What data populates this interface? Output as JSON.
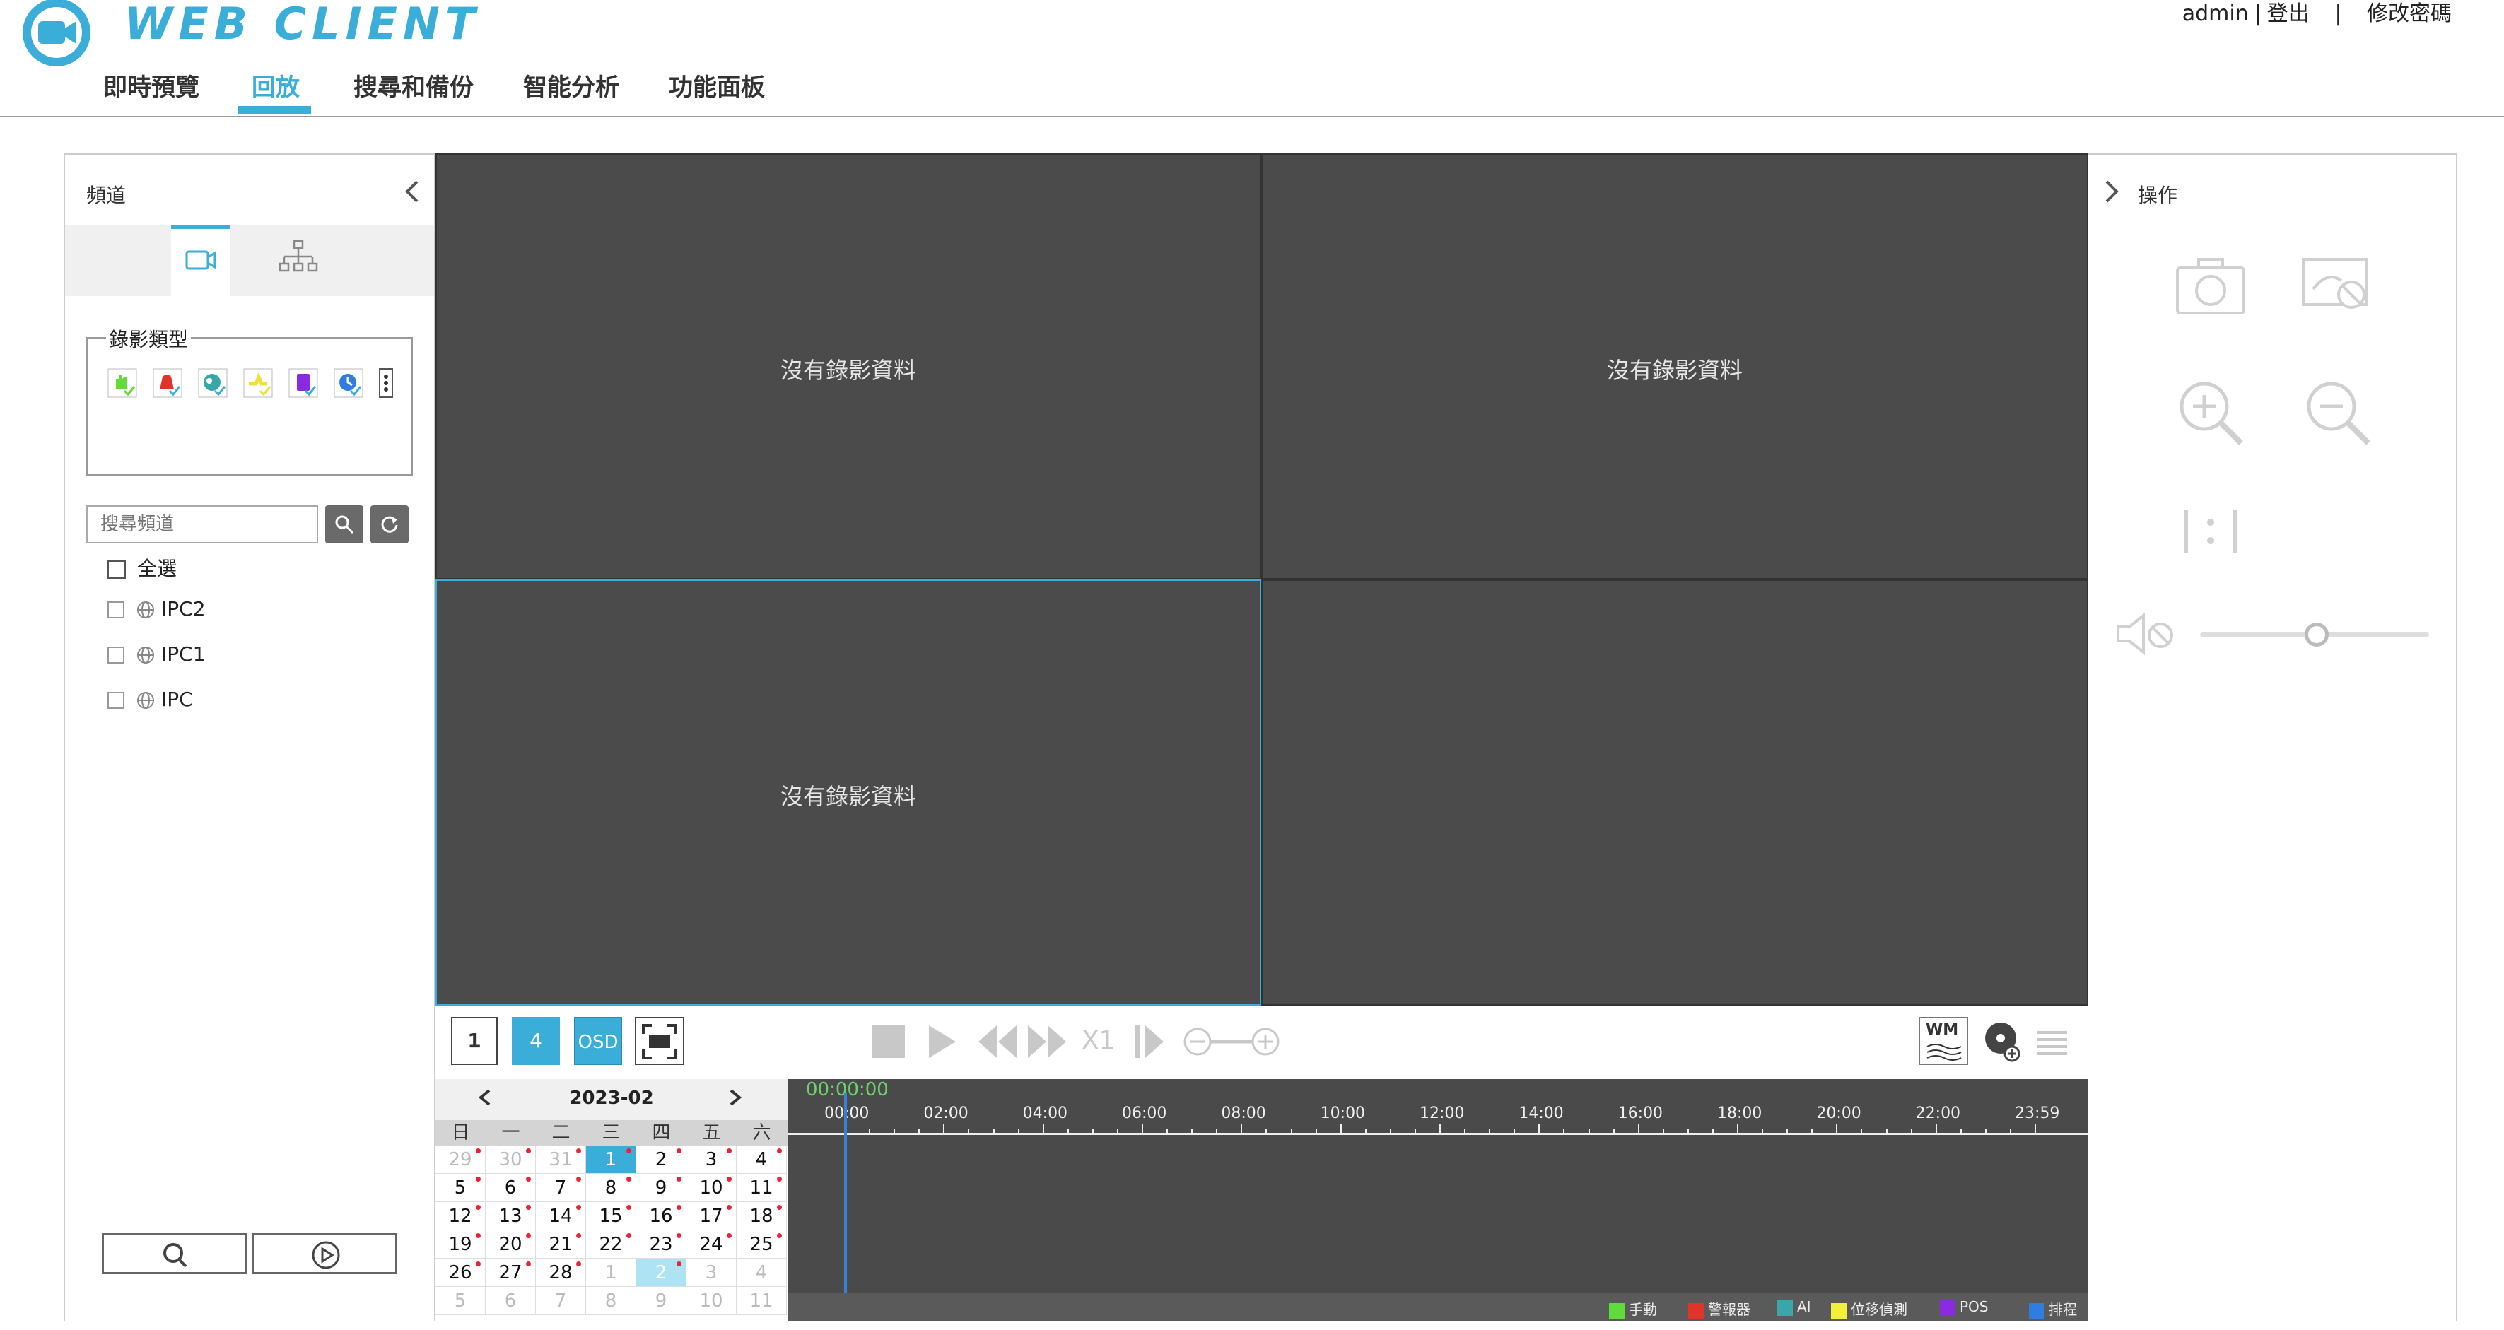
{
  "app": {
    "logo_text": "WEB CLIENT",
    "user": "admin",
    "logout": "登出",
    "change_password": "修改密碼",
    "sep1": "|",
    "sep2": "|"
  },
  "nav": {
    "items": [
      {
        "label": "即時預覽",
        "active": false
      },
      {
        "label": "回放",
        "active": true
      },
      {
        "label": "搜尋和備份",
        "active": false
      },
      {
        "label": "智能分析",
        "active": false
      },
      {
        "label": "功能面板",
        "active": false
      }
    ]
  },
  "left_panel": {
    "title": "頻道",
    "record_type_label": "錄影類型",
    "record_types": [
      "manual-record-icon",
      "alarm-record-icon",
      "ai-record-icon",
      "motion-record-icon",
      "pos-record-icon",
      "schedule-record-icon"
    ],
    "search_placeholder": "搜尋頻道",
    "select_all": "全選",
    "channels": [
      "IPC2",
      "IPC1",
      "IPC"
    ]
  },
  "video": {
    "no_record": "沒有錄影資料",
    "tiles": [
      {
        "msg": "沒有錄影資料",
        "selected": false
      },
      {
        "msg": "沒有錄影資料",
        "selected": false
      },
      {
        "msg": "沒有錄影資料",
        "selected": true
      },
      {
        "msg": "",
        "selected": false
      }
    ]
  },
  "controls": {
    "layout1": "1",
    "layout4": "4",
    "osd": "OSD",
    "speed": "X1",
    "wm": "WM"
  },
  "calendar": {
    "month": "2023-02",
    "dow": [
      "日",
      "一",
      "二",
      "三",
      "四",
      "五",
      "六"
    ],
    "weeks": [
      [
        {
          "d": "29",
          "m": true,
          "r": true
        },
        {
          "d": "30",
          "m": true,
          "r": true
        },
        {
          "d": "31",
          "m": true,
          "r": true
        },
        {
          "d": "1",
          "t": "today",
          "r": true
        },
        {
          "d": "2",
          "r": true
        },
        {
          "d": "3",
          "r": true
        },
        {
          "d": "4",
          "r": true
        }
      ],
      [
        {
          "d": "5",
          "r": true
        },
        {
          "d": "6",
          "r": true
        },
        {
          "d": "7",
          "r": true
        },
        {
          "d": "8",
          "r": true
        },
        {
          "d": "9",
          "r": true
        },
        {
          "d": "10",
          "r": true
        },
        {
          "d": "11",
          "r": true
        }
      ],
      [
        {
          "d": "12",
          "r": true
        },
        {
          "d": "13",
          "r": true
        },
        {
          "d": "14",
          "r": true
        },
        {
          "d": "15",
          "r": true
        },
        {
          "d": "16",
          "r": true
        },
        {
          "d": "17",
          "r": true
        },
        {
          "d": "18",
          "r": true
        }
      ],
      [
        {
          "d": "19",
          "r": true
        },
        {
          "d": "20",
          "r": true
        },
        {
          "d": "21",
          "r": true
        },
        {
          "d": "22",
          "r": true
        },
        {
          "d": "23",
          "r": true
        },
        {
          "d": "24",
          "r": true
        },
        {
          "d": "25",
          "r": true
        }
      ],
      [
        {
          "d": "26",
          "r": true
        },
        {
          "d": "27",
          "r": true
        },
        {
          "d": "28",
          "r": true
        },
        {
          "d": "1",
          "m": true
        },
        {
          "d": "2",
          "t": "cur",
          "r": true
        },
        {
          "d": "3",
          "m": true
        },
        {
          "d": "4",
          "m": true
        }
      ],
      [
        {
          "d": "5",
          "m": true
        },
        {
          "d": "6",
          "m": true
        },
        {
          "d": "7",
          "m": true
        },
        {
          "d": "8",
          "m": true
        },
        {
          "d": "9",
          "m": true
        },
        {
          "d": "10",
          "m": true
        },
        {
          "d": "11",
          "m": true
        }
      ]
    ]
  },
  "timeline": {
    "current_time": "00:00:00",
    "ticks": [
      "00:00",
      "02:00",
      "04:00",
      "06:00",
      "08:00",
      "10:00",
      "12:00",
      "14:00",
      "16:00",
      "18:00",
      "20:00",
      "22:00",
      "23:59"
    ],
    "legend": [
      {
        "label": "手動",
        "color": "#5fdc3c"
      },
      {
        "label": "警報器",
        "color": "#e0342b"
      },
      {
        "label": "AI",
        "color": "#3aa6a8"
      },
      {
        "label": "位移偵測",
        "color": "#f2f03a"
      },
      {
        "label": "POS",
        "color": "#8a2be2"
      },
      {
        "label": "排程",
        "color": "#2f7de0"
      }
    ]
  },
  "right_panel": {
    "title": "操作"
  },
  "colors": {
    "accent": "#3aaed8",
    "video_bg": "#4a4a4a"
  }
}
